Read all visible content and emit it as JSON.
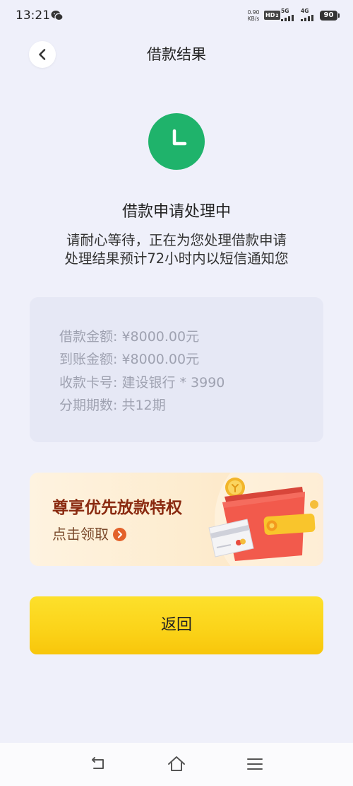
{
  "status_bar": {
    "time": "13:21",
    "app_icon": "wechat-icon",
    "net_speed": "0.90",
    "net_speed_unit": "KB/s",
    "hd_label": "HD",
    "hd_sub": "2",
    "network_1": "5G",
    "network_2": "4G",
    "battery": "90"
  },
  "header": {
    "back_icon": "chevron-left-icon",
    "title": "借款结果"
  },
  "result": {
    "icon": "clock-icon",
    "heading": "借款申请处理中",
    "message_line_1": "请耐心等待，正在为您处理借款申请",
    "message_line_2": "处理结果预计72小时内以短信通知您"
  },
  "details": [
    {
      "label": "借款金额:",
      "value": "¥8000.00元"
    },
    {
      "label": "到账金额:",
      "value": "¥8000.00元"
    },
    {
      "label": "收款卡号:",
      "value": "建设银行 * 3990"
    },
    {
      "label": "分期期数:",
      "value": "共12期"
    }
  ],
  "promo": {
    "title": "尊享优先放款特权",
    "cta": "点击领取",
    "cta_icon": "arrow-right-circle-icon",
    "illustration": "wallet-card-coin-illustration"
  },
  "primary_button": {
    "label": "返回"
  },
  "nav_bar": {
    "icons": [
      "back-icon",
      "home-icon",
      "menu-icon"
    ]
  },
  "colors": {
    "background": "#eff0fa",
    "status_green": "#1fb36b",
    "details_card": "#e6e8f5",
    "details_text": "#9fa2b1",
    "promo_title": "#8a2a10",
    "cta_orange": "#e3622b",
    "button_yellow": "#fbd41a"
  }
}
